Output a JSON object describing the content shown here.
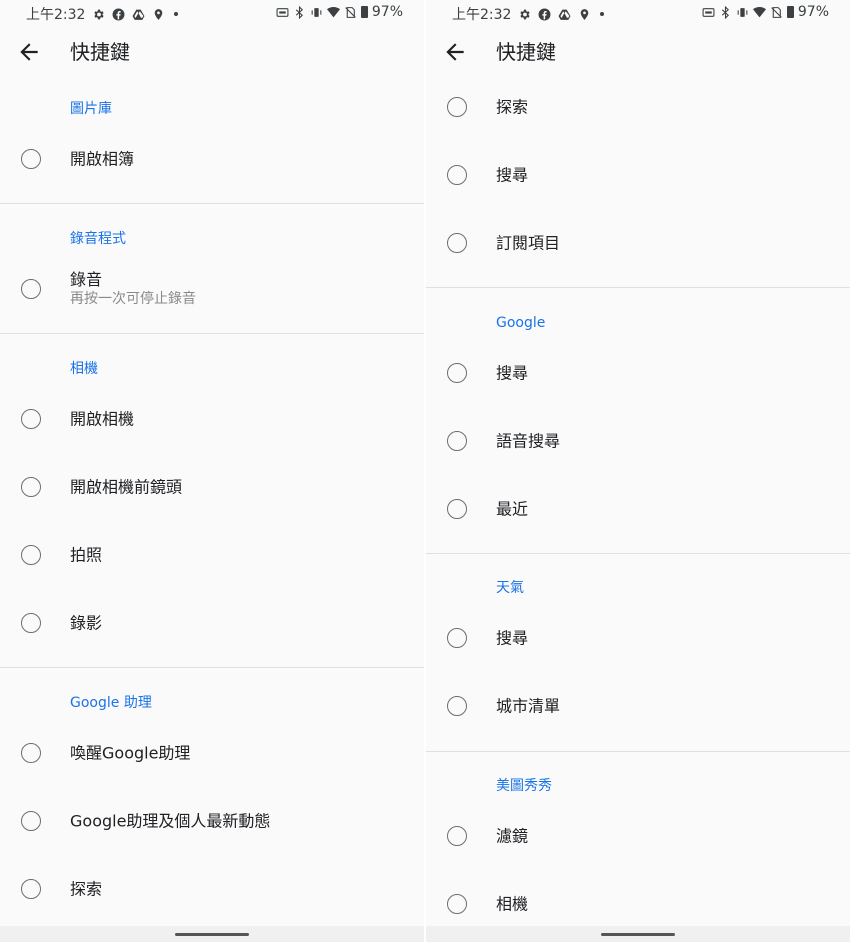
{
  "panels": [
    {
      "status": {
        "time": "上午2:32",
        "battery": "97%"
      },
      "title": "快捷鍵",
      "sections": [
        {
          "header": "圖片庫",
          "items": [
            {
              "title": "開啟相簿"
            }
          ]
        },
        {
          "header": "錄音程式",
          "items": [
            {
              "title": "錄音",
              "subtitle": "再按一次可停止錄音"
            }
          ]
        },
        {
          "header": "相機",
          "items": [
            {
              "title": "開啟相機"
            },
            {
              "title": "開啟相機前鏡頭"
            },
            {
              "title": "拍照"
            },
            {
              "title": "錄影"
            }
          ]
        },
        {
          "header": "Google 助理",
          "items": [
            {
              "title": "喚醒Google助理"
            },
            {
              "title": "Google助理及個人最新動態"
            },
            {
              "title": "探索"
            }
          ]
        }
      ]
    },
    {
      "status": {
        "time": "上午2:32",
        "battery": "97%"
      },
      "title": "快捷鍵",
      "sections": [
        {
          "header": "",
          "items": [
            {
              "title": "探索"
            },
            {
              "title": "搜尋"
            },
            {
              "title": "訂閱項目"
            }
          ]
        },
        {
          "header": "Google",
          "items": [
            {
              "title": "搜尋"
            },
            {
              "title": "語音搜尋"
            },
            {
              "title": "最近"
            }
          ]
        },
        {
          "header": "天氣",
          "items": [
            {
              "title": "搜尋"
            },
            {
              "title": "城市清單"
            }
          ]
        },
        {
          "header": "美圖秀秀",
          "items": [
            {
              "title": "濾鏡"
            },
            {
              "title": "相機"
            }
          ]
        }
      ]
    }
  ],
  "icons": [
    "gear-icon",
    "facebook-icon",
    "drive-icon",
    "location-icon",
    "auto-brightness-icon",
    "bluetooth-icon",
    "vibrate-icon",
    "wifi-icon",
    "no-sim-icon",
    "battery-icon",
    "back-arrow-icon"
  ],
  "colors": {
    "accent": "#1a73e8",
    "background": "#fafafa",
    "divider": "#dfdfdf"
  }
}
